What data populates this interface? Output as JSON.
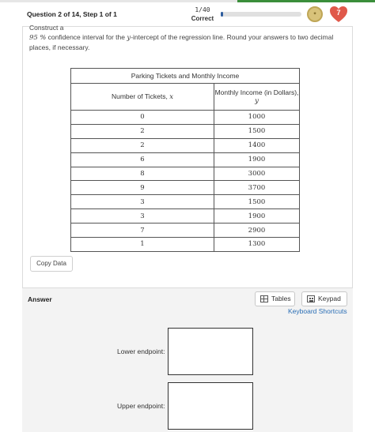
{
  "header": {
    "question_label": "Question 2 of 14, Step 1 of 1",
    "score": "1/40",
    "score_status": "Correct",
    "progress_fraction": 0.025,
    "hearts": "7",
    "accent_color": "#3b8e3b",
    "heart_color": "#e0584a"
  },
  "prompt": {
    "line1": "Construct a",
    "level": "95",
    "pct": "%",
    "text_a": "confidence interval for the",
    "var": "y",
    "text_b": "-intercept of the regression line. Round your answers to two decimal places, if necessary."
  },
  "table": {
    "caption": "Parking Tickets and Monthly Income",
    "col_x_label": "Number of Tickets,",
    "col_x_var": "x",
    "col_y_label": "Monthly Income (in Dollars),",
    "col_y_var": "y",
    "rows": [
      {
        "x": "0",
        "y": "1000"
      },
      {
        "x": "2",
        "y": "1500"
      },
      {
        "x": "2",
        "y": "1400"
      },
      {
        "x": "6",
        "y": "1900"
      },
      {
        "x": "8",
        "y": "3000"
      },
      {
        "x": "9",
        "y": "3700"
      },
      {
        "x": "3",
        "y": "1500"
      },
      {
        "x": "3",
        "y": "1900"
      },
      {
        "x": "7",
        "y": "2900"
      },
      {
        "x": "1",
        "y": "1300"
      }
    ]
  },
  "copy_data_label": "Copy Data",
  "answer": {
    "label": "Answer",
    "tables_label": "Tables",
    "keypad_label": "Keypad",
    "shortcuts_label": "Keyboard Shortcuts",
    "lower_label": "Lower endpoint:",
    "upper_label": "Upper endpoint:",
    "lower_value": "",
    "upper_value": ""
  }
}
